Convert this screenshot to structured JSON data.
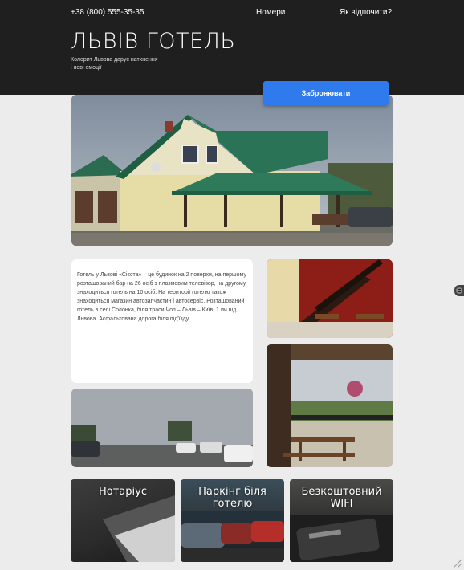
{
  "header": {
    "phone": "+38 (800) 555-35-35",
    "nav": [
      {
        "label": "Номери"
      },
      {
        "label": "Як відпочити?"
      }
    ],
    "title": "ЛЬВІВ ГОТЕЛЬ",
    "subtitle": "Колорит Львова дарує натхнення і нові емоції",
    "book_button": "Забронювати"
  },
  "about": {
    "text": "Готель у Львові «Сієста» – це будинок на 2 поверхи, на першому розташований бар на 26 осіб з плазмовим телевізор, на другому знаходиться готель на 10 осіб. На території готелю також знаходиться магазин автозапчастин і автосервіс. Розташований готель в селі Солонка, біля траси Чоп – Львів – Київ, 1 км від Львова. Асфальтована дорога біля під'їзду."
  },
  "features": [
    {
      "title": "Нотаріус"
    },
    {
      "title": "Паркінг біля готелю"
    },
    {
      "title": "Безкоштовний WIFI"
    }
  ],
  "colors": {
    "header_bg": "#1f1f1f",
    "accent": "#2f7bee",
    "page_bg": "#ececec"
  }
}
